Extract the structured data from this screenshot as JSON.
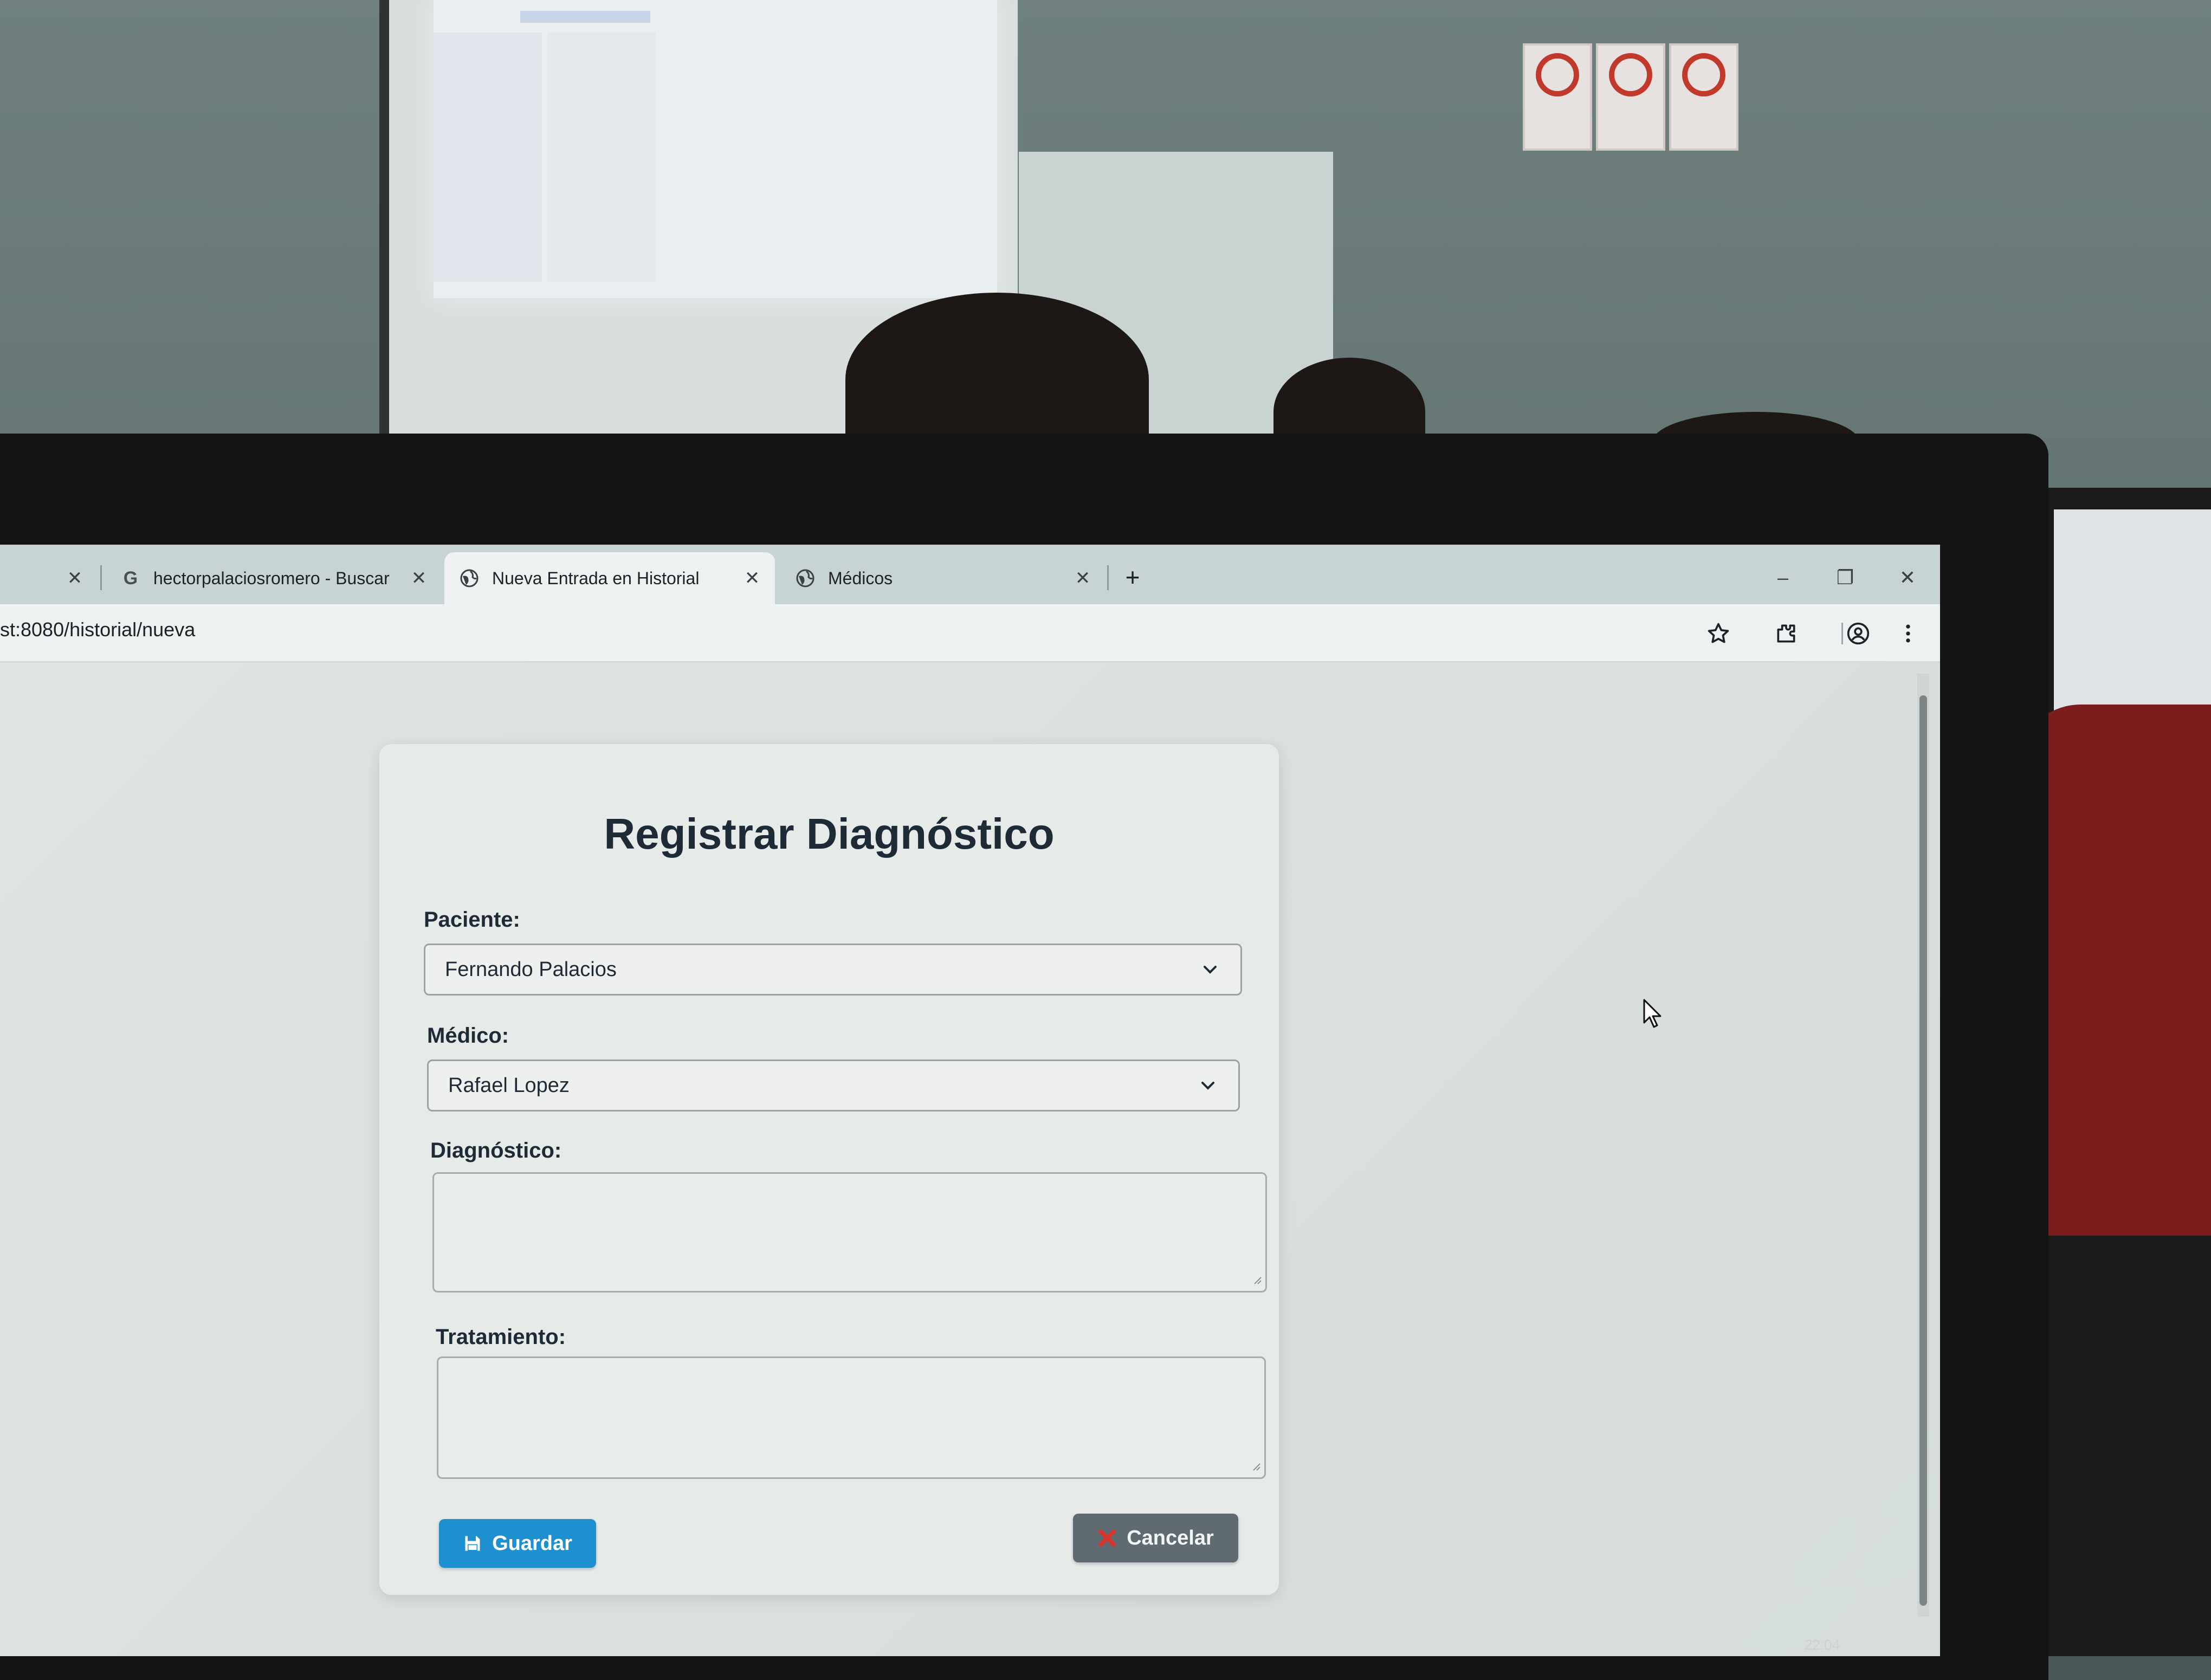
{
  "browser": {
    "tabs": [
      {
        "title": "",
        "icon": "blank"
      },
      {
        "title": "hectorpalaciosromero - Buscar",
        "icon": "google-g-icon"
      },
      {
        "title": "Nueva Entrada en Historial",
        "icon": "globe-icon",
        "active": true
      },
      {
        "title": "Médicos",
        "icon": "globe-icon"
      }
    ],
    "tab_close": "✕",
    "new_tab": "+",
    "window_controls": {
      "minimize": "–",
      "restore": "❐",
      "close": "✕"
    },
    "url": "st:8080/historial/nueva",
    "toolbar_icons": [
      "star-icon",
      "extensions-icon",
      "profile-icon",
      "menu-icon"
    ]
  },
  "form": {
    "title": "Registrar Diagnóstico",
    "paciente": {
      "label": "Paciente:",
      "selected": "Fernando Palacios"
    },
    "medico": {
      "label": "Médico:",
      "selected": "Rafael Lopez"
    },
    "diagnostico": {
      "label": "Diagnóstico:",
      "value": ""
    },
    "tratamiento": {
      "label": "Tratamiento:",
      "value": ""
    },
    "save_label": "Guardar",
    "cancel_label": "Cancelar"
  },
  "colors": {
    "save_button": "#1e8fcf",
    "cancel_button": "#5f6b70",
    "cancel_icon": "#d9342b"
  },
  "system": {
    "clock": "22:04"
  }
}
